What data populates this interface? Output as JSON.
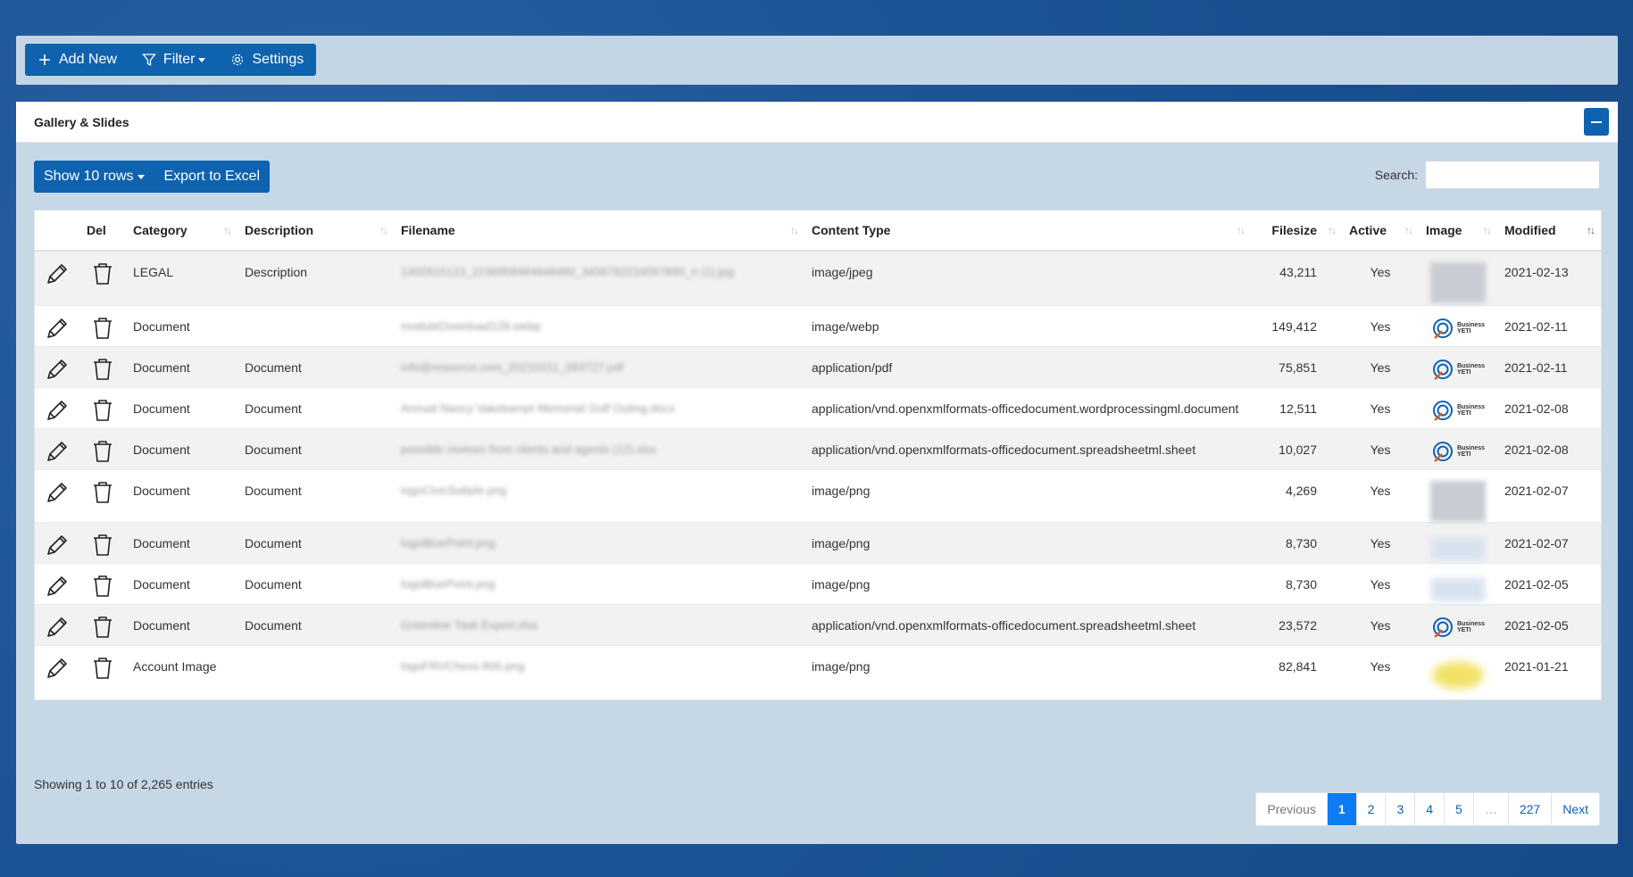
{
  "toolbar": {
    "add_new": "Add New",
    "filter": "Filter",
    "settings": "Settings"
  },
  "panel": {
    "title": "Gallery & Slides"
  },
  "controls": {
    "show_rows": "Show 10 rows",
    "export": "Export to Excel",
    "search_label": "Search:",
    "search_value": ""
  },
  "table": {
    "headers": [
      "",
      "Del",
      "Category",
      "Description",
      "Filename",
      "Content Type",
      "Filesize",
      "Active",
      "Image",
      "Modified"
    ],
    "rows": [
      {
        "category": "LEGAL",
        "description": "Description",
        "filename": "1492815123_2236958484848480_3456782234567890_n (1).jpg",
        "content_type": "image/jpeg",
        "filesize": "43,211",
        "active": "Yes",
        "image": "blur",
        "modified": "2021-02-13"
      },
      {
        "category": "Document",
        "description": "",
        "filename": "moduleDownload128.webp",
        "content_type": "image/webp",
        "filesize": "149,412",
        "active": "Yes",
        "image": "logo",
        "modified": "2021-02-11"
      },
      {
        "category": "Document",
        "description": "Document",
        "filename": "info@resource.com_20210211_093727.pdf",
        "content_type": "application/pdf",
        "filesize": "75,851",
        "active": "Yes",
        "image": "logo",
        "modified": "2021-02-11"
      },
      {
        "category": "Document",
        "description": "Document",
        "filename": "Annual Nancy Vakebampt Memorial Golf Outing.docx",
        "content_type": "application/vnd.openxmlformats-officedocument.wordprocessingml.document",
        "filesize": "12,511",
        "active": "Yes",
        "image": "logo",
        "modified": "2021-02-08"
      },
      {
        "category": "Document",
        "description": "Document",
        "filename": "possible reviews from clients and agents (12).xlsx",
        "content_type": "application/vnd.openxmlformats-officedocument.spreadsheetml.sheet",
        "filesize": "10,027",
        "active": "Yes",
        "image": "logo",
        "modified": "2021-02-08"
      },
      {
        "category": "Document",
        "description": "Document",
        "filename": "logoCivicSubple.png",
        "content_type": "image/png",
        "filesize": "4,269",
        "active": "Yes",
        "image": "blur",
        "modified": "2021-02-07"
      },
      {
        "category": "Document",
        "description": "Document",
        "filename": "logoBluePoint.png",
        "content_type": "image/png",
        "filesize": "8,730",
        "active": "Yes",
        "image": "light",
        "modified": "2021-02-07"
      },
      {
        "category": "Document",
        "description": "Document",
        "filename": "logoBluePoint.png",
        "content_type": "image/png",
        "filesize": "8,730",
        "active": "Yes",
        "image": "light",
        "modified": "2021-02-05"
      },
      {
        "category": "Document",
        "description": "Document",
        "filename": "Greenline Task Export.xlsx",
        "content_type": "application/vnd.openxmlformats-officedocument.spreadsheetml.sheet",
        "filesize": "23,572",
        "active": "Yes",
        "image": "logo",
        "modified": "2021-02-05"
      },
      {
        "category": "Account Image",
        "description": "",
        "filename": "logoFRVChess-800.png",
        "content_type": "image/png",
        "filesize": "82,841",
        "active": "Yes",
        "image": "yellow",
        "modified": "2021-01-21"
      }
    ]
  },
  "logo_text": {
    "line1": "Business",
    "line2": "YETI"
  },
  "footer": {
    "info": "Showing 1 to 10 of 2,265 entries",
    "pages": [
      "Previous",
      "1",
      "2",
      "3",
      "4",
      "5",
      "…",
      "227",
      "Next"
    ]
  },
  "colors": {
    "primary": "#0e62ae",
    "active_page": "#0d7cf2"
  }
}
